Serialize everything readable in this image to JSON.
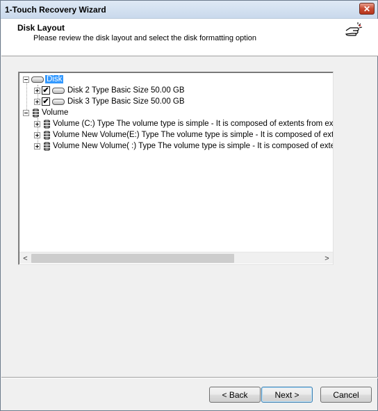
{
  "window": {
    "title": "1-Touch Recovery Wizard",
    "close_glyph": "✕"
  },
  "header": {
    "title": "Disk Layout",
    "subtitle": "Please review the disk layout and select the disk formatting option",
    "icon": "hand-pointer-icon"
  },
  "tree": {
    "disk_group": {
      "label": "Disk",
      "items": [
        {
          "label": "Disk 2 Type Basic Size 50.00 GB",
          "checked": true
        },
        {
          "label": "Disk 3 Type Basic Size 50.00 GB",
          "checked": true
        }
      ]
    },
    "volume_group": {
      "label": "Volume",
      "items": [
        {
          "label": "Volume (C:) Type The volume type is simple - It is composed of extents from exactly"
        },
        {
          "label": "Volume New Volume(E:) Type The volume type is simple - It is composed of extents"
        },
        {
          "label": "Volume New Volume( :) Type The volume type is simple - It is composed of extents f"
        }
      ]
    }
  },
  "scrollbar": {
    "left_arrow": "<",
    "right_arrow": ">"
  },
  "buttons": {
    "back": "< Back",
    "next": "Next >",
    "cancel": "Cancel"
  },
  "colors": {
    "selection": "#3399ff",
    "close_button": "#c74b32"
  }
}
